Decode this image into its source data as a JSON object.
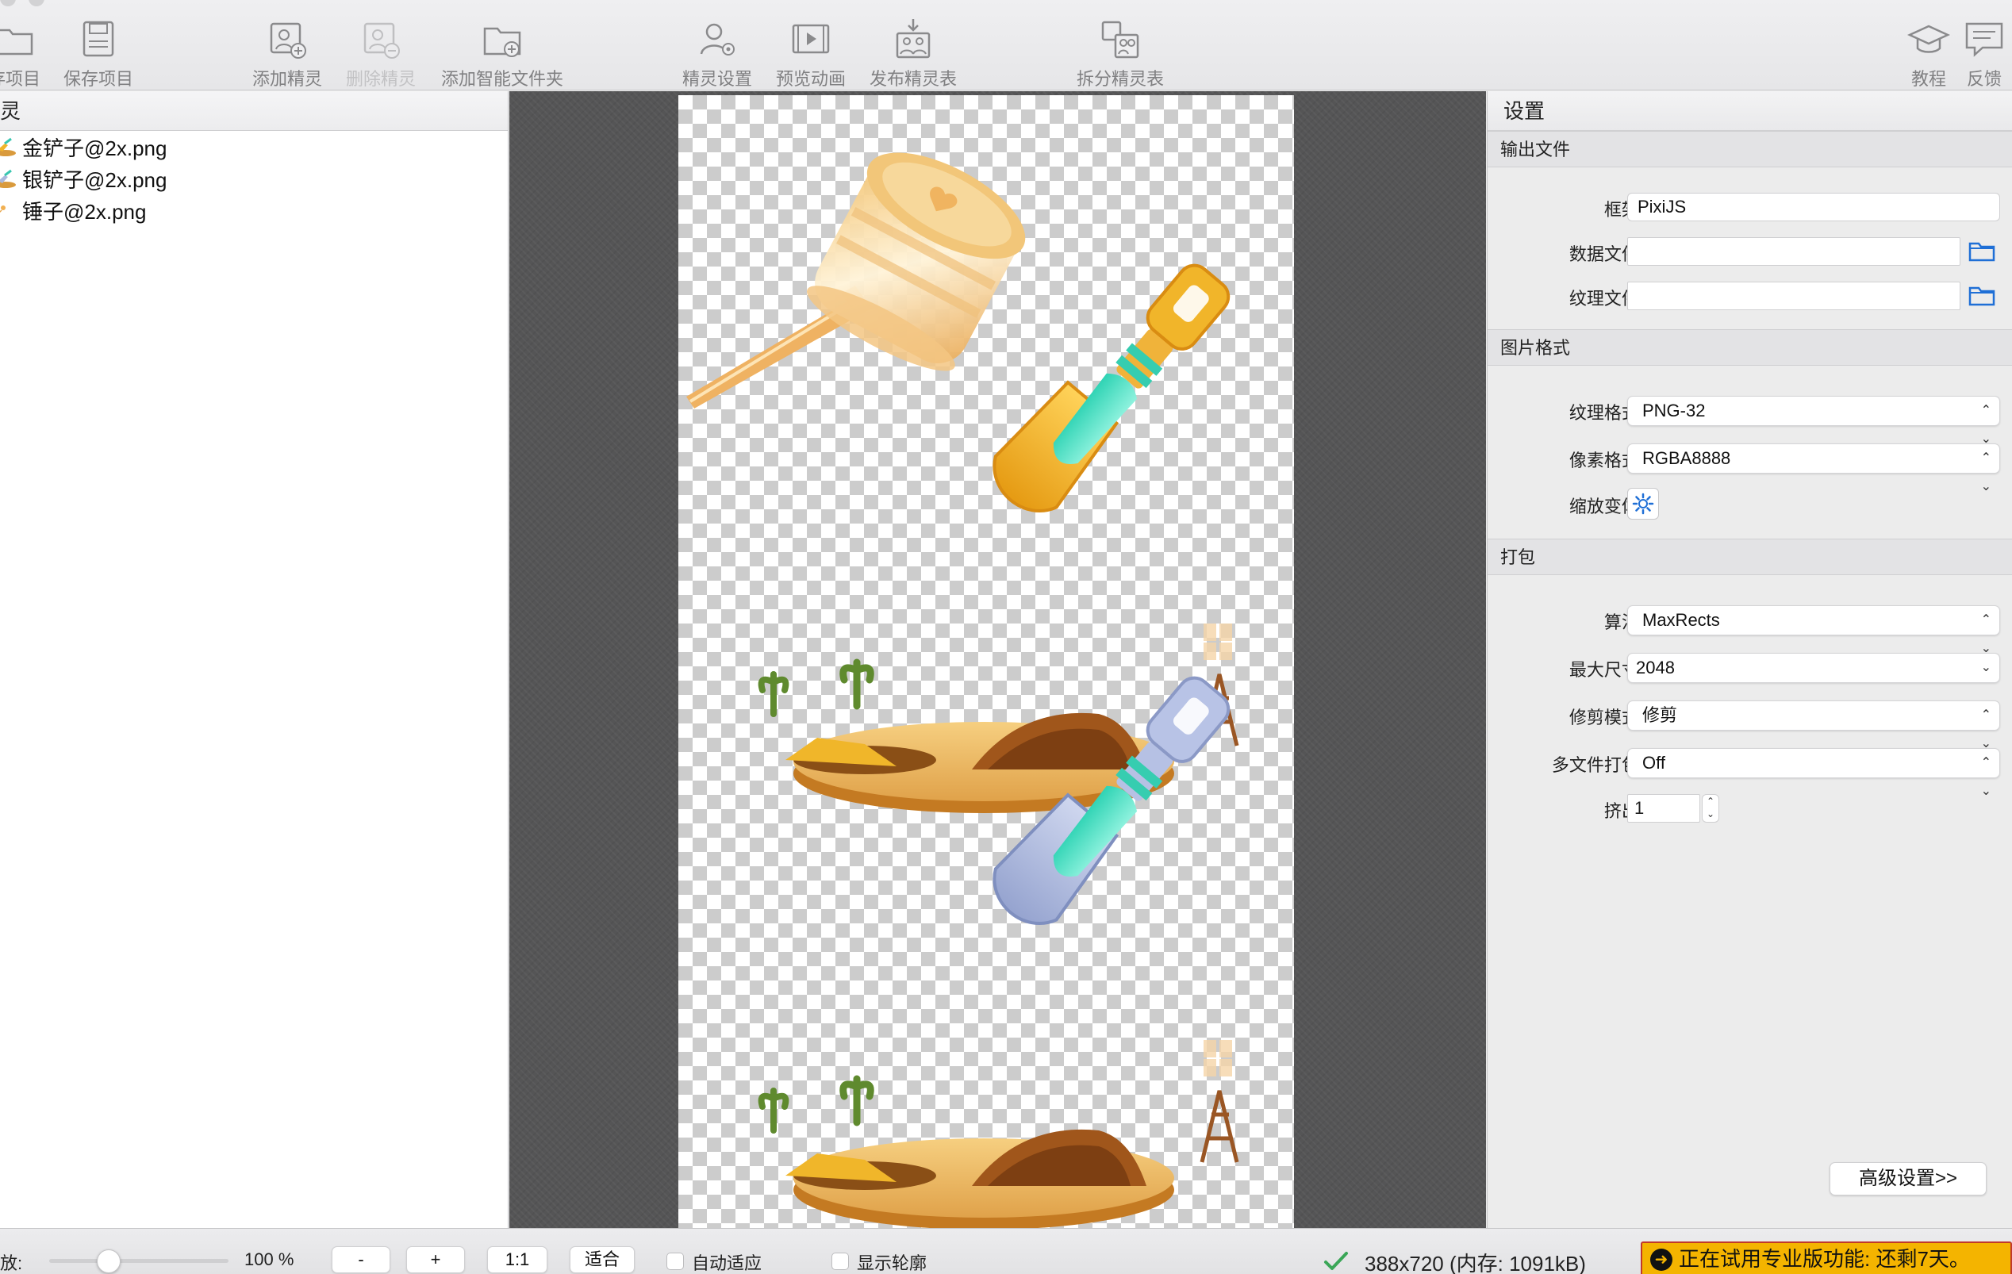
{
  "toolbar": {
    "items": [
      {
        "label": "存项目",
        "icon": "folder-icon",
        "disabled": false
      },
      {
        "label": "保存项目",
        "icon": "save-icon",
        "disabled": false
      },
      {
        "label": "添加精灵",
        "icon": "add-sprite-icon",
        "disabled": false
      },
      {
        "label": "删除精灵",
        "icon": "delete-sprite-icon",
        "disabled": true
      },
      {
        "label": "添加智能文件夹",
        "icon": "add-smart-folder-icon",
        "disabled": false
      },
      {
        "label": "精灵设置",
        "icon": "sprite-settings-icon",
        "disabled": false
      },
      {
        "label": "预览动画",
        "icon": "preview-animation-icon",
        "disabled": false
      },
      {
        "label": "发布精灵表",
        "icon": "publish-sheet-icon",
        "disabled": false
      },
      {
        "label": "拆分精灵表",
        "icon": "split-sheet-icon",
        "disabled": false
      },
      {
        "label": "教程",
        "icon": "tutorial-icon",
        "disabled": false
      },
      {
        "label": "反馈",
        "icon": "feedback-icon",
        "disabled": false
      }
    ]
  },
  "left_panel": {
    "header": "灵",
    "sprites": [
      {
        "name": "金铲子@2x.png",
        "icon": "gold-shovel-thumb-icon"
      },
      {
        "name": "银铲子@2x.png",
        "icon": "silver-shovel-thumb-icon"
      },
      {
        "name": "锤子@2x.png",
        "icon": "hammer-thumb-icon"
      }
    ]
  },
  "right_panel": {
    "title": "设置",
    "sections": {
      "output": "输出文件",
      "image_format": "图片格式",
      "packing": "打包"
    },
    "fields": {
      "framework_label": "框架:",
      "framework_value": "PixiJS",
      "data_file_label": "数据文件:",
      "data_file_value": "",
      "texture_file_label": "纹理文件:",
      "texture_file_value": "",
      "texture_format_label": "纹理格式:",
      "texture_format_value": "PNG-32",
      "pixel_format_label": "像素格式:",
      "pixel_format_value": "RGBA8888",
      "scaling_label": "缩放变体:",
      "algorithm_label": "算法:",
      "algorithm_value": "MaxRects",
      "max_size_label": "最大尺寸:",
      "max_size_value": "2048",
      "trim_mode_label": "修剪模式:",
      "trim_mode_value": "修剪",
      "multipack_label": "多文件打包:",
      "multipack_value": "Off",
      "extrude_label": "挤出:",
      "extrude_value": "1"
    },
    "advanced_button": "高级设置>>"
  },
  "statusbar": {
    "zoom_label": "放:",
    "zoom_value": "100 %",
    "zoom_fraction": 0.33,
    "minus_label": "-",
    "plus_label": "+",
    "one_to_one_label": "1:1",
    "fit_label": "适合",
    "auto_fit_label": "自动适应",
    "show_outline_label": "显示轮廓",
    "sheet_info": "388x720 (内存: 1091kB)",
    "trial_banner": "正在试用专业版功能: 还剩7天。"
  },
  "colors": {
    "canvas_bg": "#555556",
    "trial_bg": "#f4b400",
    "accent_blue": "#1f6fd6",
    "ok_green": "#3aa657"
  }
}
